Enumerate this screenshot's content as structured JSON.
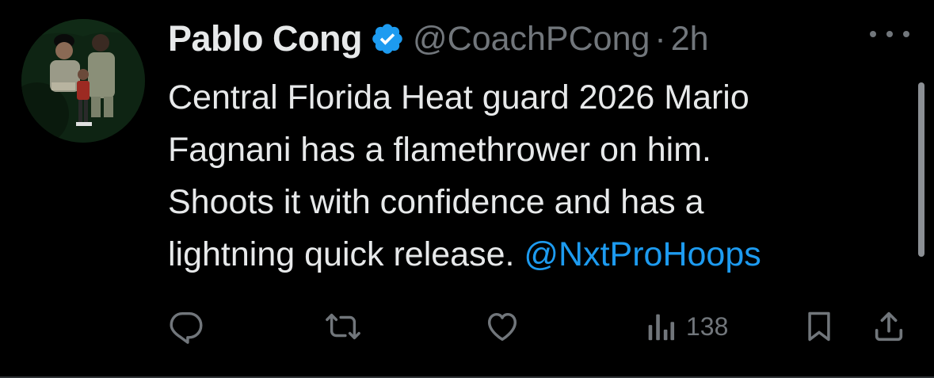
{
  "tweet": {
    "display_name": "Pablo Cong",
    "handle": "@CoachPCong",
    "separator": "·",
    "time": "2h",
    "text_lines": [
      "Central Florida Heat guard 2026 Mario",
      "Fagnani has a flamethrower on him.",
      "Shoots it with confidence and has a",
      "lightning quick release. "
    ],
    "mention": "@NxtProHoops",
    "views": "138"
  },
  "colors": {
    "background": "#000000",
    "text": "#e7e9ea",
    "muted": "#71767b",
    "accent": "#1d9bf0",
    "verified_badge": "#1d9bf0"
  },
  "icons": {
    "verified": "verified-badge-icon",
    "more": "more-options-icon",
    "reply": "reply-icon",
    "retweet": "retweet-icon",
    "like": "like-icon",
    "views": "views-icon",
    "bookmark": "bookmark-icon",
    "share": "share-icon"
  }
}
